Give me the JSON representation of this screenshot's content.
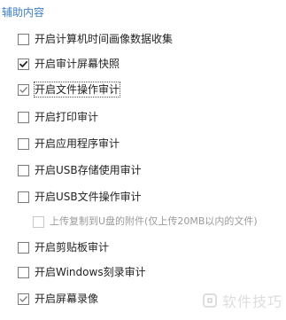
{
  "section": {
    "title": "辅助内容"
  },
  "options": [
    {
      "label": "开启计算机时间画像数据收集",
      "checked": false,
      "style": "none",
      "disabled": false,
      "focused": false
    },
    {
      "label": "开启审计屏幕快照",
      "checked": true,
      "style": "dark",
      "disabled": false,
      "focused": false
    },
    {
      "label": "开启文件操作审计",
      "checked": true,
      "style": "light",
      "disabled": false,
      "focused": true
    },
    {
      "label": "开启打印审计",
      "checked": false,
      "style": "none",
      "disabled": false,
      "focused": false
    },
    {
      "label": "开启应用程序审计",
      "checked": false,
      "style": "none",
      "disabled": false,
      "focused": false
    },
    {
      "label": "开启USB存储使用审计",
      "checked": false,
      "style": "none",
      "disabled": false,
      "focused": false
    },
    {
      "label": "开启USB文件操作审计",
      "checked": false,
      "style": "none",
      "disabled": false,
      "focused": false
    },
    {
      "label": "上传复制到U盘的附件(仅上传20MB以内的文件)",
      "checked": false,
      "style": "none",
      "disabled": true,
      "focused": false
    },
    {
      "label": "开启剪贴板审计",
      "checked": false,
      "style": "none",
      "disabled": false,
      "focused": false
    },
    {
      "label": "开启Windows刻录审计",
      "checked": false,
      "style": "none",
      "disabled": false,
      "focused": false
    },
    {
      "label": "开启屏幕录像",
      "checked": true,
      "style": "light",
      "disabled": false,
      "focused": false
    }
  ],
  "watermark": {
    "text": "软件技巧",
    "icon": "app-logo-icon"
  },
  "colors": {
    "title": "#3d7fc8",
    "text": "#222222",
    "disabled_text": "#9a9a9a",
    "checkbox_border": "#7a7a7a"
  }
}
